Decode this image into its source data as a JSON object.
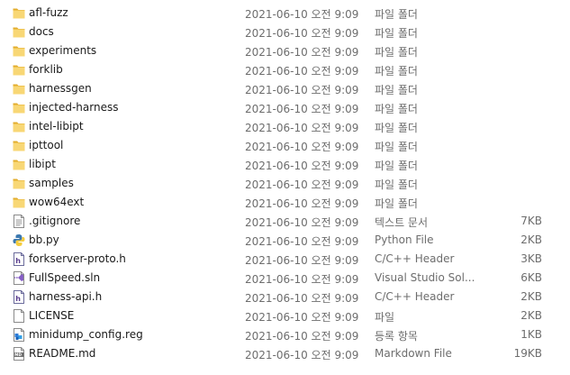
{
  "files": [
    {
      "name": "afl-fuzz",
      "date": "2021-06-10 오전 9:09",
      "type": "파일 폴더",
      "size": "",
      "icon": "folder-icon"
    },
    {
      "name": "docs",
      "date": "2021-06-10 오전 9:09",
      "type": "파일 폴더",
      "size": "",
      "icon": "folder-icon"
    },
    {
      "name": "experiments",
      "date": "2021-06-10 오전 9:09",
      "type": "파일 폴더",
      "size": "",
      "icon": "folder-icon"
    },
    {
      "name": "forklib",
      "date": "2021-06-10 오전 9:09",
      "type": "파일 폴더",
      "size": "",
      "icon": "folder-icon"
    },
    {
      "name": "harnessgen",
      "date": "2021-06-10 오전 9:09",
      "type": "파일 폴더",
      "size": "",
      "icon": "folder-icon"
    },
    {
      "name": "injected-harness",
      "date": "2021-06-10 오전 9:09",
      "type": "파일 폴더",
      "size": "",
      "icon": "folder-icon"
    },
    {
      "name": "intel-libipt",
      "date": "2021-06-10 오전 9:09",
      "type": "파일 폴더",
      "size": "",
      "icon": "folder-icon"
    },
    {
      "name": "ipttool",
      "date": "2021-06-10 오전 9:09",
      "type": "파일 폴더",
      "size": "",
      "icon": "folder-icon"
    },
    {
      "name": "libipt",
      "date": "2021-06-10 오전 9:09",
      "type": "파일 폴더",
      "size": "",
      "icon": "folder-icon"
    },
    {
      "name": "samples",
      "date": "2021-06-10 오전 9:09",
      "type": "파일 폴더",
      "size": "",
      "icon": "folder-icon"
    },
    {
      "name": "wow64ext",
      "date": "2021-06-10 오전 9:09",
      "type": "파일 폴더",
      "size": "",
      "icon": "folder-icon"
    },
    {
      "name": ".gitignore",
      "date": "2021-06-10 오전 9:09",
      "type": "텍스트 문서",
      "size": "7KB",
      "icon": "text-file-icon"
    },
    {
      "name": "bb.py",
      "date": "2021-06-10 오전 9:09",
      "type": "Python File",
      "size": "2KB",
      "icon": "python-file-icon"
    },
    {
      "name": "forkserver-proto.h",
      "date": "2021-06-10 오전 9:09",
      "type": "C/C++ Header",
      "size": "3KB",
      "icon": "header-file-icon"
    },
    {
      "name": "FullSpeed.sln",
      "date": "2021-06-10 오전 9:09",
      "type": "Visual Studio Sol...",
      "size": "6KB",
      "icon": "solution-file-icon"
    },
    {
      "name": "harness-api.h",
      "date": "2021-06-10 오전 9:09",
      "type": "C/C++ Header",
      "size": "2KB",
      "icon": "header-file-icon"
    },
    {
      "name": "LICENSE",
      "date": "2021-06-10 오전 9:09",
      "type": "파일",
      "size": "2KB",
      "icon": "blank-file-icon"
    },
    {
      "name": "minidump_config.reg",
      "date": "2021-06-10 오전 9:09",
      "type": "등록 항목",
      "size": "1KB",
      "icon": "registry-file-icon"
    },
    {
      "name": "README.md",
      "date": "2021-06-10 오전 9:09",
      "type": "Markdown File",
      "size": "19KB",
      "icon": "markdown-file-icon"
    }
  ]
}
